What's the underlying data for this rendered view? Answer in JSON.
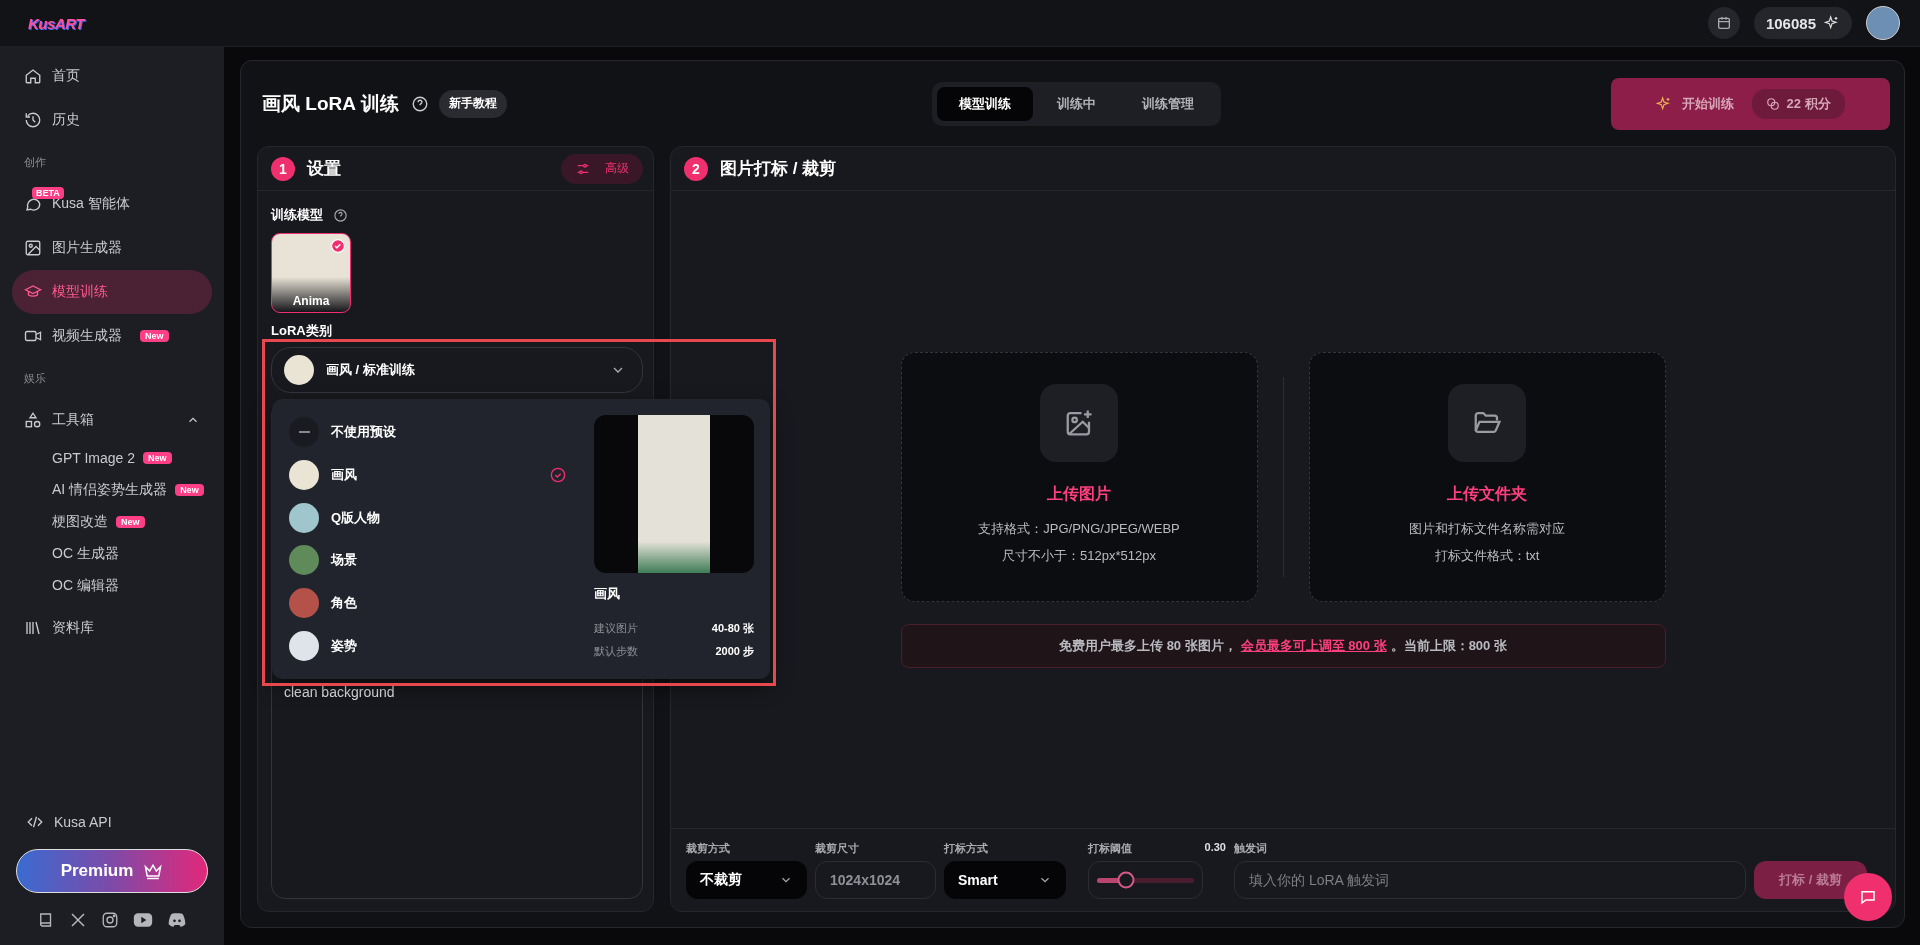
{
  "top_bar": {
    "logo": "KusART",
    "credits": "106085"
  },
  "sidebar": {
    "entries": [
      {
        "kind": "item",
        "label": "首页",
        "selected": false
      },
      {
        "kind": "item",
        "label": "历史",
        "selected": false
      },
      {
        "kind": "section",
        "label": "创作"
      },
      {
        "kind": "item",
        "label": "Kusa 智能体",
        "selected": false,
        "top_badge": "BETA"
      },
      {
        "kind": "item",
        "label": "图片生成器",
        "selected": false
      },
      {
        "kind": "item",
        "label": "模型训练",
        "selected": true
      },
      {
        "kind": "item",
        "label": "视频生成器",
        "selected": false,
        "badge": "New"
      },
      {
        "kind": "section",
        "label": "娱乐"
      },
      {
        "kind": "group",
        "label": "工具箱",
        "expanded": true,
        "children": [
          {
            "label": "GPT Image 2",
            "badge": "New",
            "selected": false
          },
          {
            "label": "AI 情侣姿势生成器",
            "badge": "New",
            "selected": false
          },
          {
            "label": "梗图改造",
            "badge": "New",
            "selected": false
          },
          {
            "label": "OC 生成器",
            "selected": false
          },
          {
            "label": "OC 编辑器",
            "selected": false
          }
        ]
      },
      {
        "kind": "item",
        "label": "资料库",
        "selected": false
      }
    ],
    "api_link": "Kusa API",
    "premium_button": "Premium"
  },
  "header": {
    "title": "画风 LoRA 训练",
    "tutorial_button": "新手教程",
    "tabs": [
      {
        "label": "模型训练",
        "selected": true
      },
      {
        "label": "训练中",
        "selected": false
      },
      {
        "label": "训练管理",
        "selected": false
      }
    ],
    "start_button": {
      "label": "开始训练",
      "cost": "22 积分"
    }
  },
  "settings": {
    "step": "1",
    "title": "设置",
    "advanced_button": "高级",
    "model_label": "训练模型",
    "models": [
      {
        "name": "Anima",
        "selected": true
      }
    ],
    "category_label": "LoRA类别",
    "category_select": {
      "value": "画风 / 标准训练",
      "expanded": true
    },
    "options": [
      {
        "kind": "none",
        "label": "不使用预设",
        "selected": false
      },
      {
        "kind": "preset",
        "label": "画风",
        "selected": true
      },
      {
        "kind": "preset",
        "label": "Q版人物",
        "selected": false
      },
      {
        "kind": "preset",
        "label": "场景",
        "selected": false
      },
      {
        "kind": "preset",
        "label": "角色",
        "selected": false
      },
      {
        "kind": "preset",
        "label": "姿势",
        "selected": false
      }
    ],
    "preview": {
      "title": "画风",
      "stats": [
        {
          "label": "建议图片",
          "value": "40-80 张"
        },
        {
          "label": "默认步数",
          "value": "2000 步"
        }
      ]
    },
    "prompt_value": "clean background",
    "highlight_frame": true
  },
  "images": {
    "step": "2",
    "title": "图片打标 / 裁剪",
    "upload_cards": [
      {
        "title": "上传图片",
        "lines": [
          "支持格式：JPG/PNG/JPEG/WEBP",
          "尺寸不小于：512px*512px"
        ]
      },
      {
        "title": "上传文件夹",
        "lines": [
          "图片和打标文件名称需对应",
          "打标文件格式：txt"
        ]
      }
    ],
    "notice": {
      "before": "免费用户最多上传 80 张图片，",
      "link": "会员最多可上调至 800 张",
      "after": "。当前上限：800 张"
    },
    "toolbar": {
      "crop_mode": {
        "label": "裁剪方式",
        "value": "不裁剪"
      },
      "crop_size": {
        "label": "裁剪尺寸",
        "value": "1024x1024",
        "disabled": true
      },
      "tag_mode": {
        "label": "打标方式",
        "value": "Smart"
      },
      "threshold": {
        "label": "打标阈值",
        "reading": "0.30",
        "level": 0.3
      },
      "trigger": {
        "label": "触发词",
        "placeholder": "填入你的 LoRA 触发词"
      },
      "run_button": {
        "label": "打标 / 裁剪",
        "disabled": true
      }
    }
  }
}
